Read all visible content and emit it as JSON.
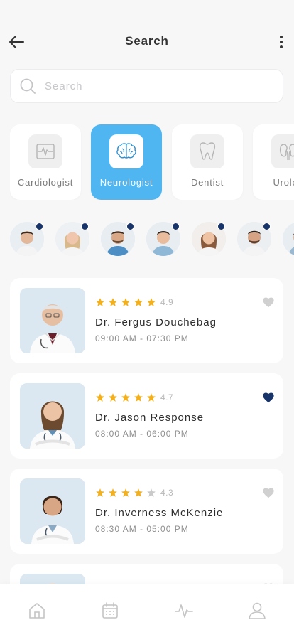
{
  "header": {
    "title": "Search"
  },
  "search": {
    "placeholder": "Search",
    "value": ""
  },
  "categories": [
    {
      "label": "Cardiologist",
      "icon": "heart-monitor-icon",
      "active": false
    },
    {
      "label": "Neurologist",
      "icon": "brain-icon",
      "active": true
    },
    {
      "label": "Dentist",
      "icon": "tooth-icon",
      "active": false
    },
    {
      "label": "Urolog",
      "icon": "kidney-icon",
      "active": false
    }
  ],
  "avatars": {
    "count_visible": 7,
    "online_dot_color": "#17346b"
  },
  "doctors": [
    {
      "name": "Dr. Fergus Douchebag",
      "rating": "4.9",
      "stars": 5,
      "hours": "09:00 AM - 07:30 PM",
      "favorite": false
    },
    {
      "name": "Dr. Jason Response",
      "rating": "4.7",
      "stars": 5,
      "hours": "08:00 AM - 06:00 PM",
      "favorite": true
    },
    {
      "name": "Dr. Inverness McKenzie",
      "rating": "4.3",
      "stars": 4,
      "hours": "08:30 AM - 05:00 PM",
      "favorite": false
    }
  ],
  "bottom_nav": [
    {
      "icon": "home-icon"
    },
    {
      "icon": "calendar-icon"
    },
    {
      "icon": "activity-icon"
    },
    {
      "icon": "profile-icon"
    }
  ],
  "colors": {
    "accent": "#4fb6f2",
    "star": "#f2b01e",
    "star_empty": "#c9c9c9",
    "heart_active": "#17346b",
    "heart_inactive": "#d0d0d0"
  }
}
